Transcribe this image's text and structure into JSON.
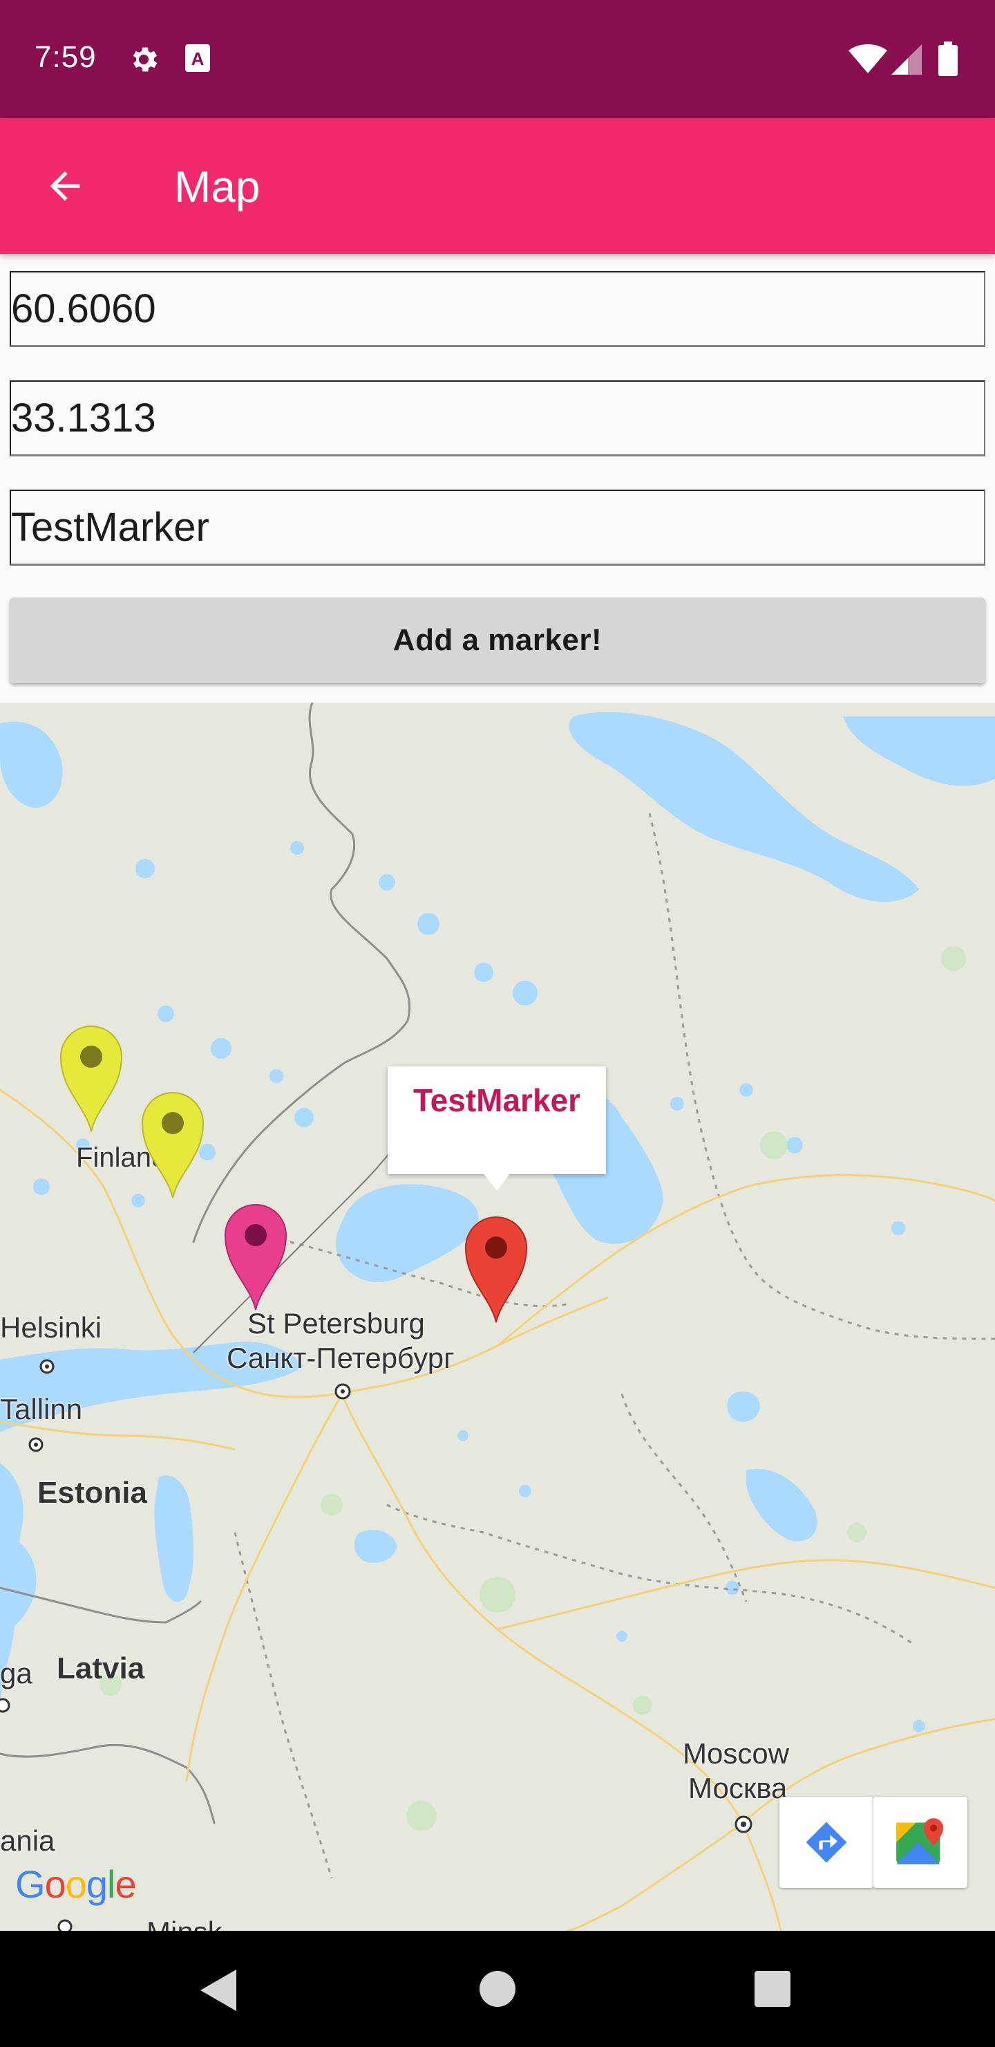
{
  "status_bar": {
    "time": "7:59",
    "icons": [
      "gear-icon",
      "a-notification-icon",
      "wifi-icon",
      "signal-icon",
      "battery-icon"
    ]
  },
  "app_bar": {
    "title": "Map",
    "back_icon": "arrow-left-icon"
  },
  "form": {
    "latitude_value": "60.6060",
    "longitude_value": "33.1313",
    "name_value": "TestMarker",
    "add_button_label": "Add a marker!"
  },
  "map": {
    "info_window_title": "TestMarker",
    "labels": {
      "finland": "Finland",
      "helsinki": "Helsinki",
      "tallinn": "Tallinn",
      "st_petersburg": "St Petersburg",
      "st_petersburg_ru": "Санкт-Петербург",
      "estonia": "Estonia",
      "latvia": "Latvia",
      "riga_partial": "ga",
      "lithuania_partial": "ania",
      "moscow": "Moscow",
      "moscow_ru": "Москва",
      "minsk_partial": "Minsk"
    },
    "markers": [
      {
        "name": "marker-yellow-1",
        "color": "#e6e83a"
      },
      {
        "name": "marker-yellow-2",
        "color": "#e6e83a"
      },
      {
        "name": "marker-pink",
        "color": "#e83e8c"
      },
      {
        "name": "marker-red",
        "color": "#ea4335"
      }
    ],
    "buttons": {
      "directions_icon": "directions-icon",
      "google_maps_icon": "google-maps-icon"
    },
    "google_logo": {
      "letters": [
        "G",
        "o",
        "o",
        "g",
        "l",
        "e"
      ],
      "colors": [
        "#4285f4",
        "#ea4335",
        "#fbbc05",
        "#4285f4",
        "#34a853",
        "#ea4335"
      ]
    }
  },
  "nav_bar": {
    "icons": [
      "back-triangle-icon",
      "home-circle-icon",
      "recents-square-icon"
    ]
  },
  "colors": {
    "status_bar": "#880e4f",
    "app_bar": "#f22a6c",
    "map_land": "#e6e8dd",
    "map_water": "#aadaff",
    "accent": "#c2185b"
  }
}
